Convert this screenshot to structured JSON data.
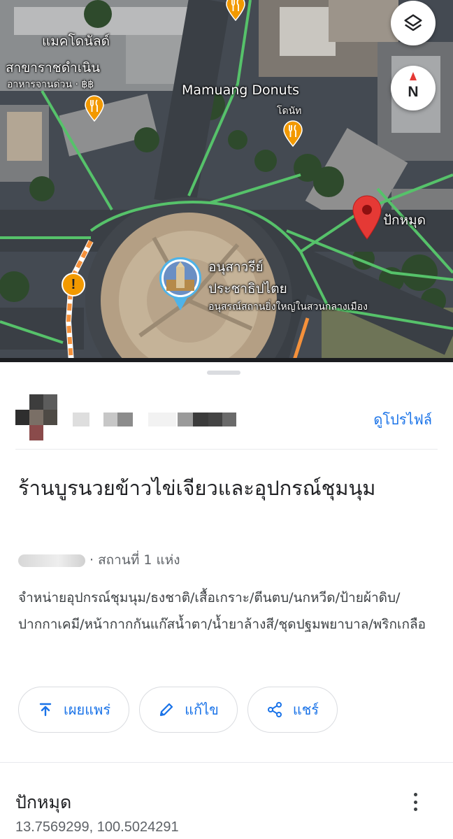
{
  "map": {
    "labels": {
      "mcd_name": "แมคโดนัลด์",
      "mcd_branch": "สาขาราชดำเนิน",
      "mcd_cat": "อาหารจานด่วน · ฿฿",
      "donut_name": "Mamuang Donuts",
      "donut_cat": "โดนัท",
      "pin_label": "ปักหมุด",
      "monument_line1": "อนุสาวรีย์",
      "monument_line2": "ประชาธิปไตย",
      "monument_desc": "อนุสรณ์สถานยิ่งใหญ่ในสวนกลางเมือง"
    },
    "compass_letter": "N",
    "warning_glyph": "!",
    "icons": {
      "layers": "layers-icon",
      "restaurant": "fork-knife-icon",
      "pin": "red-location-pin-icon"
    },
    "colors": {
      "road_green": "#56c26a",
      "road_orange": "#f5913b",
      "pin_red": "#e53935",
      "poi_orange": "#f29900"
    }
  },
  "sheet": {
    "view_profile": "ดูโปรไฟล์",
    "title": "ร้านบูรนวยข้าวไข่เจียวและอุปกรณ์ชุมนุม",
    "subline": "· สถานที่ 1 แห่ง",
    "description": "จำหน่ายอุปกรณ์ชุมนุม/ธงชาติ/เสื้อเกราะ/ตีนตบ/นกหวีด/ป้ายผ้าดิบ/ปากกาเคมี/หน้ากากกันแก๊สน้ำตา/น้ำยาล้างสี/ชุดปฐมพยาบาล/พริกเกลือ",
    "actions": [
      {
        "label": "เผยแพร่",
        "icon": "publish-icon"
      },
      {
        "label": "แก้ไข",
        "icon": "pencil-icon"
      },
      {
        "label": "แชร์",
        "icon": "share-icon"
      }
    ],
    "pin_title": "ปักหมุด",
    "coordinates": "13.7569299, 100.5024291",
    "accent": "#1a73e8"
  }
}
